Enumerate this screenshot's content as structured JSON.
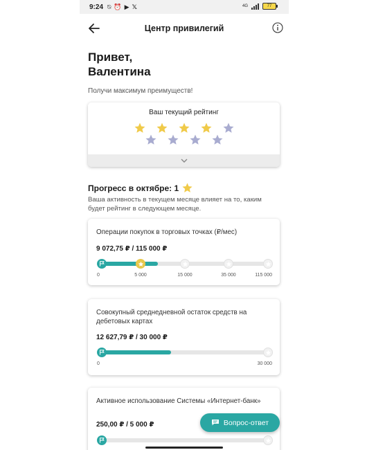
{
  "statusbar": {
    "time": "9:24",
    "battery": "77"
  },
  "header": {
    "title": "Центр привилегий"
  },
  "greeting": {
    "line1": "Привет,",
    "line2": "Валентина"
  },
  "subtitle": "Получи максимум преимуществ!",
  "rating": {
    "title": "Ваш текущий рейтинг",
    "gold_stars": 4,
    "total_stars": 9,
    "gold_color": "#f0ca49",
    "grey_color": "#a9acd0"
  },
  "progress": {
    "title": "Прогресс в октябре: 1",
    "description": "Ваша активность в текущем месяце влияет на то, каким будет рейтинг в следующем месяце."
  },
  "cards": [
    {
      "title": "Операции покупок в торговых точках (₽/мес)",
      "amount": "9 072,75 ₽ / 115 000 ₽",
      "ticks": [
        "0",
        "5 000",
        "15 000",
        "35 000",
        "115 000"
      ],
      "progress_value": 9072.75
    },
    {
      "title": "Совокупный среднедневной остаток средств на дебетовых картах",
      "amount": "12 627,79 ₽ / 30 000 ₽",
      "ticks": [
        "0",
        "30 000"
      ],
      "progress_value": 12627.79
    },
    {
      "title": "Активное использование Системы «Интернет-банк»",
      "amount": "250,00 ₽ / 5 000 ₽"
    }
  ],
  "fab": {
    "label": "Вопрос-ответ"
  },
  "colors": {
    "accent": "#2aa7a3"
  }
}
